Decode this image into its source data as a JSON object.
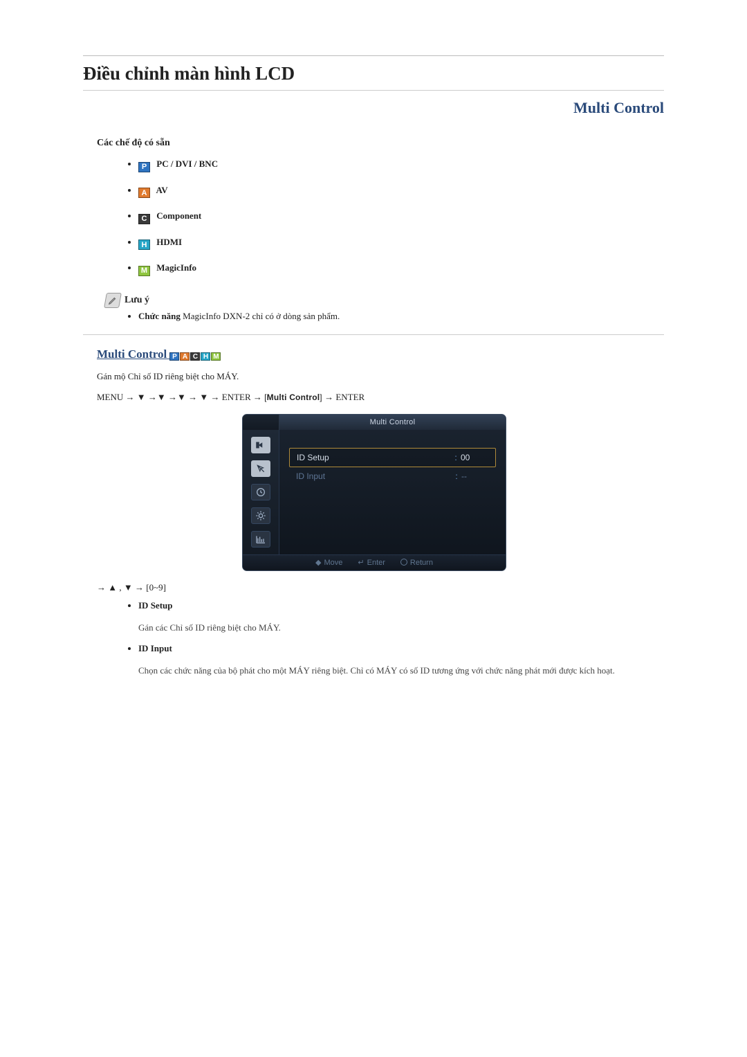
{
  "page_title": "Điều chỉnh màn hình LCD",
  "right_heading": "Multi Control",
  "modes_heading": "Các chế độ có sẵn",
  "modes": {
    "p": {
      "glyph": "P",
      "label": "PC / DVI / BNC"
    },
    "a": {
      "glyph": "A",
      "label": "AV"
    },
    "c": {
      "glyph": "C",
      "label": "Component"
    },
    "h": {
      "glyph": "H",
      "label": "HDMI"
    },
    "m": {
      "glyph": "M",
      "label": "MagicInfo"
    }
  },
  "note": {
    "heading": "Lưu ý",
    "bold_lead": "Chức năng",
    "text": " MagicInfo DXN-2 chỉ có ở dòng sản phẩm."
  },
  "section": {
    "title": "Multi Control",
    "intro": "Gán mộ Chỉ số ID riêng biệt cho MÁY.",
    "menu_prefix": "MENU → ▼ →▼ →▼ → ▼ → ENTER → ",
    "menu_boxed": "Multi Control",
    "menu_suffix": "→ ENTER",
    "post_path": "→ ▲ , ▼ → [0~9]",
    "items": {
      "id_setup": {
        "term": "ID Setup",
        "desc": "Gán các Chỉ số ID riêng biệt cho MÁY."
      },
      "id_input": {
        "term": "ID Input",
        "desc": "Chọn các chức năng của bộ phát cho một MÁY riêng biệt. Chỉ có MÁY có số ID tương ứng với chức năng phát mới được kích hoạt."
      }
    }
  },
  "osd": {
    "title": "Multi Control",
    "rows": {
      "id_setup": {
        "label": "ID Setup",
        "value": "00"
      },
      "id_input": {
        "label": "ID Input",
        "value": "--"
      }
    },
    "footer": {
      "move": "Move",
      "enter": "Enter",
      "return": "Return"
    }
  }
}
